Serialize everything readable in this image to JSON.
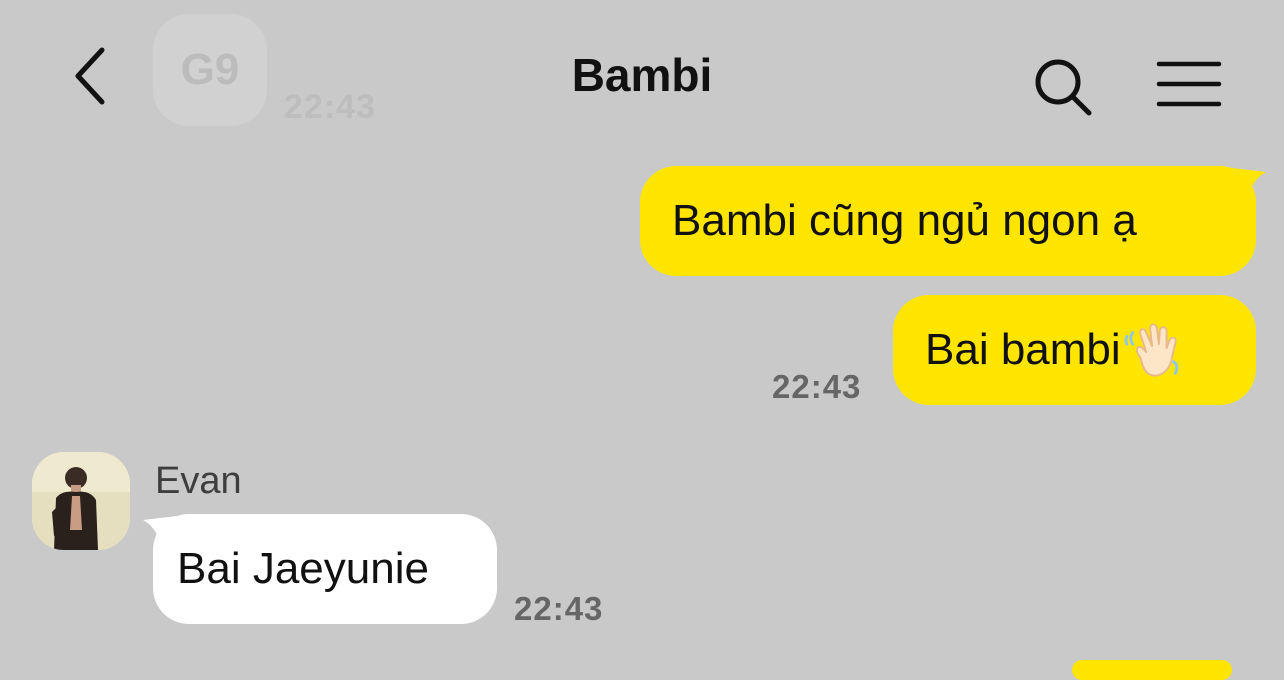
{
  "header": {
    "title": "Bambi",
    "back_icon": "chevron-left-icon",
    "search_icon": "search-icon",
    "menu_icon": "hamburger-menu-icon",
    "ghost_avatar_text": "G9",
    "ghost_time": "22:43"
  },
  "messages": [
    {
      "direction": "outgoing",
      "text": "Bambi cũng ngủ ngon ạ",
      "time": ""
    },
    {
      "direction": "outgoing",
      "text": "Bai bambi",
      "emoji": "waving-hand-icon",
      "time": "22:43"
    },
    {
      "direction": "incoming",
      "sender": "Evan",
      "text": "Bai Jaeyunie",
      "time": "22:43"
    }
  ],
  "colors": {
    "background": "#c9c9c9",
    "outgoing_bubble": "#fee500",
    "incoming_bubble": "#ffffff",
    "time_text": "#666666"
  }
}
